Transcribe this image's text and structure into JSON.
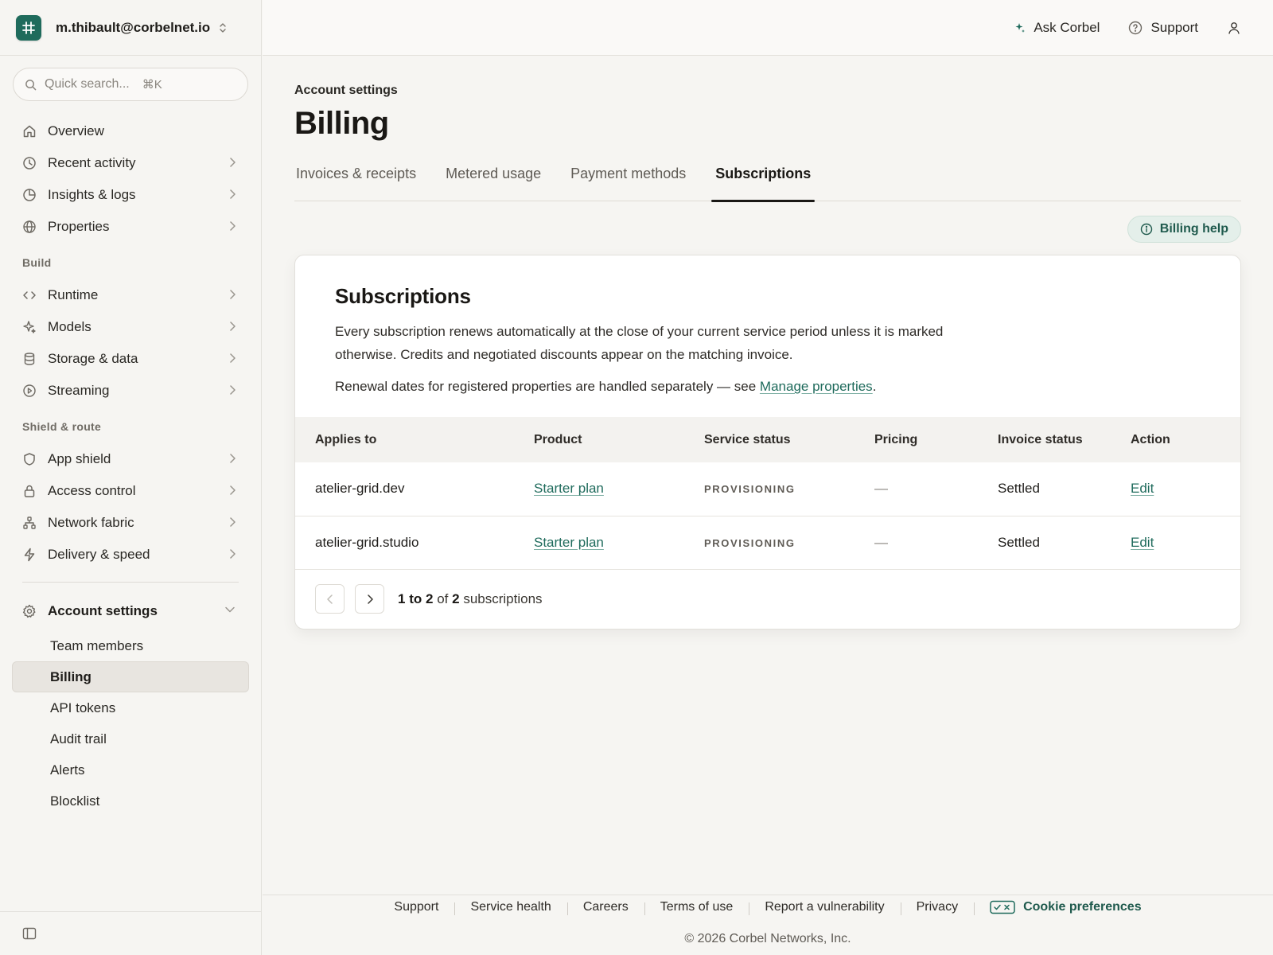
{
  "account": {
    "email": "m.thibault@corbelnet.io"
  },
  "search": {
    "placeholder": "Quick search...",
    "shortcut": "⌘K"
  },
  "sidebar": {
    "primary": [
      {
        "label": "Overview"
      },
      {
        "label": "Recent activity"
      },
      {
        "label": "Insights & logs"
      },
      {
        "label": "Properties"
      }
    ],
    "build_heading": "Build",
    "build": [
      {
        "label": "Runtime"
      },
      {
        "label": "Models"
      },
      {
        "label": "Storage & data"
      },
      {
        "label": "Streaming"
      }
    ],
    "shield_heading": "Shield & route",
    "shield": [
      {
        "label": "App shield"
      },
      {
        "label": "Access control"
      },
      {
        "label": "Network fabric"
      },
      {
        "label": "Delivery & speed"
      }
    ],
    "settings_label": "Account settings",
    "settings_items": [
      {
        "label": "Team members"
      },
      {
        "label": "Billing"
      },
      {
        "label": "API tokens"
      },
      {
        "label": "Audit trail"
      },
      {
        "label": "Alerts"
      },
      {
        "label": "Blocklist"
      }
    ]
  },
  "topbar": {
    "ask": "Ask Corbel",
    "support": "Support"
  },
  "page": {
    "breadcrumb": "Account settings",
    "title": "Billing",
    "tabs": [
      "Invoices & receipts",
      "Metered usage",
      "Payment methods",
      "Subscriptions"
    ],
    "help_label": "Billing help"
  },
  "card": {
    "title": "Subscriptions",
    "description": "Every subscription renews automatically at the close of your current service period unless it is marked otherwise. Credits and negotiated discounts appear on the matching invoice.",
    "note_prefix": "Renewal dates for registered properties are handled separately — see ",
    "note_link": "Manage properties",
    "note_suffix": "."
  },
  "table": {
    "headers": [
      "Applies to",
      "Product",
      "Service status",
      "Pricing",
      "Invoice status",
      "Action"
    ],
    "rows": [
      {
        "applies_to": "atelier-grid.dev",
        "product": "Starter plan",
        "service_status": "PROVISIONING",
        "pricing": "—",
        "invoice_status": "Settled",
        "action": "Edit"
      },
      {
        "applies_to": "atelier-grid.studio",
        "product": "Starter plan",
        "service_status": "PROVISIONING",
        "pricing": "—",
        "invoice_status": "Settled",
        "action": "Edit"
      }
    ]
  },
  "pager": {
    "from": "1",
    "to_word": "to",
    "to": "2",
    "of_word": "of",
    "total": "2",
    "unit": "subscriptions"
  },
  "footer": {
    "links": [
      "Support",
      "Service health",
      "Careers",
      "Terms of use",
      "Report a vulnerability",
      "Privacy"
    ],
    "cookie": "Cookie preferences",
    "copyright": "© 2026 Corbel Networks, Inc."
  }
}
